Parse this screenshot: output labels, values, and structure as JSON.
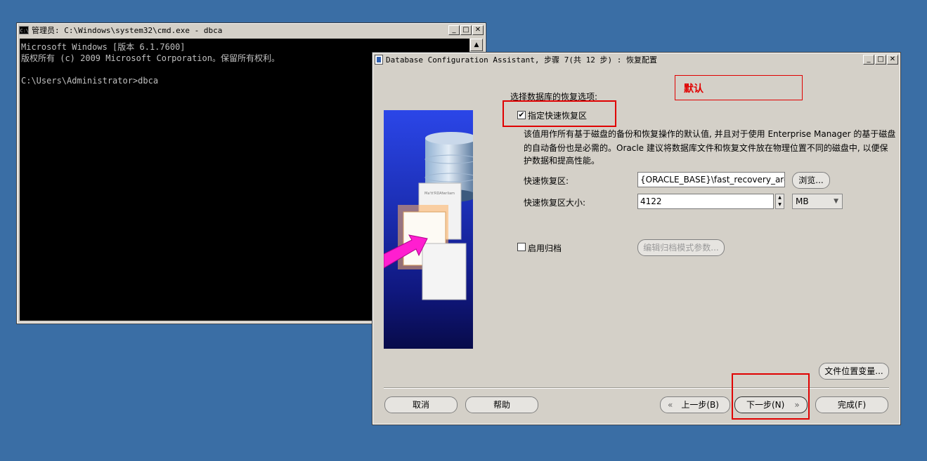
{
  "cmd_window": {
    "title": "管理员: C:\\Windows\\system32\\cmd.exe - dbca",
    "lines": [
      "Microsoft Windows [版本 6.1.7600]",
      "版权所有 (c) 2009 Microsoft Corporation。保留所有权利。",
      "",
      "C:\\Users\\Administrator>dbca"
    ]
  },
  "caption_buttons": {
    "minimize": "_",
    "maximize": "□",
    "close": "✕"
  },
  "dbca": {
    "title": "Database Configuration Assistant, 步骤 7(共 12 步) : 恢复配置",
    "annotation": "默认",
    "section_label": "选择数据库的恢复选项:",
    "fast_recovery_checkbox": {
      "label": "指定快速恢复区",
      "checked": true
    },
    "description_line1": "该值用作所有基于磁盘的备份和恢复操作的默认值, 并且对于使用 Enterprise Manager 的基于磁盘",
    "description_line2": "的自动备份也是必需的。Oracle 建议将数据库文件和恢复文件放在物理位置不同的磁盘中, 以便保",
    "description_line3": "护数据和提高性能。",
    "fast_recovery_area": {
      "label": "快速恢复区:",
      "value": "{ORACLE_BASE}\\fast_recovery_area",
      "browse": "浏览..."
    },
    "fast_recovery_size": {
      "label": "快速恢复区大小:",
      "value": "4122",
      "unit": "MB"
    },
    "archive_checkbox": {
      "label": "启用归档",
      "checked": false
    },
    "edit_archive_button": "编辑归档模式参数...",
    "file_location_button": "文件位置变量...",
    "cancel_button": "取消",
    "help_button": "帮助",
    "back_button": "上一步(B)",
    "next_button": "下一步(N)",
    "finish_button": "完成(F)",
    "art_doc_text": "Ma'tt'RDAfwrliam"
  }
}
